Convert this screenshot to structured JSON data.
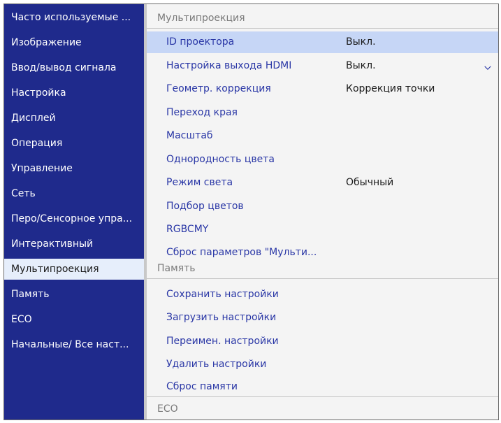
{
  "sidebar": {
    "items": [
      {
        "label": "Часто используемые ..."
      },
      {
        "label": "Изображение"
      },
      {
        "label": "Ввод/вывод сигнала"
      },
      {
        "label": "Настройка"
      },
      {
        "label": "Дисплей"
      },
      {
        "label": "Операция"
      },
      {
        "label": "Управление"
      },
      {
        "label": "Сеть"
      },
      {
        "label": "Перо/Сенсорное упра..."
      },
      {
        "label": "Интерактивный"
      },
      {
        "label": "Мультипроекция",
        "selected": true
      },
      {
        "label": "Память"
      },
      {
        "label": "ECO"
      },
      {
        "label": "Начальные/ Все наст..."
      }
    ]
  },
  "main": {
    "multi": {
      "header": "Мультипроекция",
      "rows": [
        {
          "label": "ID проектора",
          "value": "Выкл.",
          "selected": true
        },
        {
          "label": "Настройка выхода HDMI",
          "value": "Выкл.",
          "expandable": true
        },
        {
          "label": "Геометр. коррекция",
          "value": "Коррекция точки"
        },
        {
          "label": "Переход края",
          "value": ""
        },
        {
          "label": "Масштаб",
          "value": ""
        },
        {
          "label": "Однородность цвета",
          "value": ""
        },
        {
          "label": "Режим света",
          "value": "Обычный"
        },
        {
          "label": "Подбор цветов",
          "value": ""
        },
        {
          "label": "RGBCMY",
          "value": ""
        },
        {
          "label": "Сброс параметров \"Мульти...",
          "value": ""
        }
      ]
    },
    "memory": {
      "header": "Память",
      "rows": [
        {
          "label": "Сохранить настройки"
        },
        {
          "label": "Загрузить настройки"
        },
        {
          "label": "Переимен. настройки"
        },
        {
          "label": "Удалить настройки"
        },
        {
          "label": "Сброс памяти"
        }
      ]
    },
    "eco": {
      "header": "ECO"
    }
  },
  "colors": {
    "sidebar_bg": "#1f2a8c",
    "selected_sidebar_bg": "#e6eefb",
    "highlight_row_bg": "#c6d6f6",
    "label_text": "#2a37a6",
    "value_text": "#1b1b1b",
    "header_text": "#7a7a7a"
  },
  "icons": {
    "expand": "chevron-down-icon"
  }
}
